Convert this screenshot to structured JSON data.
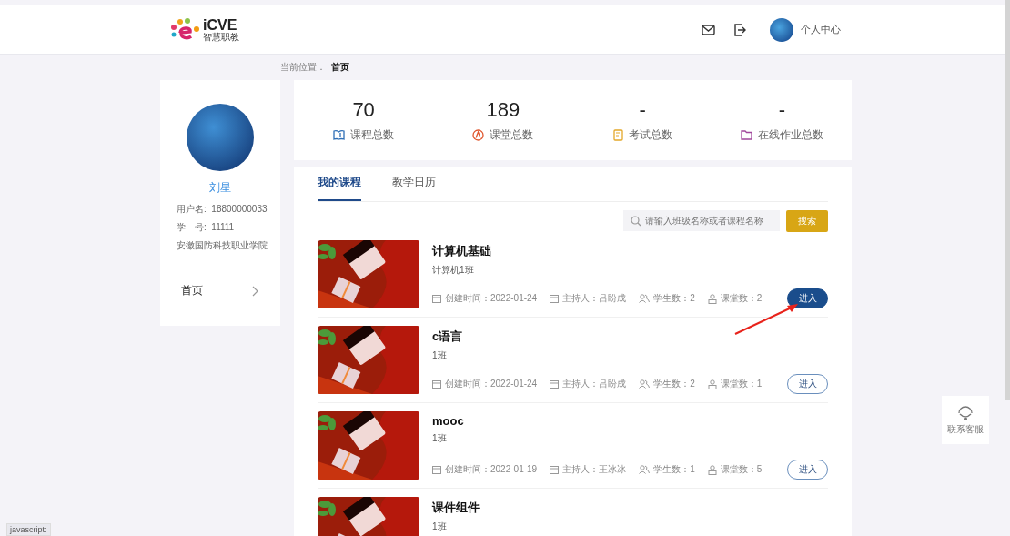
{
  "header": {
    "logo_text": "iCVE",
    "logo_subtext": "智慧职教",
    "user_link": "个人中心"
  },
  "breadcrumb": {
    "label": "当前位置：",
    "current": "首页"
  },
  "profile": {
    "name": "刘星",
    "fields": [
      {
        "label": "用户名:",
        "value": "18800000033"
      },
      {
        "label": "学　号:",
        "value": "11111"
      }
    ],
    "school": "安徽国防科技职业学院",
    "nav": [
      {
        "label": "首页"
      }
    ]
  },
  "stats": [
    {
      "kind": "course",
      "value": "70",
      "label": "课程总数"
    },
    {
      "kind": "classroom",
      "value": "189",
      "label": "课堂总数"
    },
    {
      "kind": "exam",
      "value": "-",
      "label": "考试总数"
    },
    {
      "kind": "homework",
      "value": "-",
      "label": "在线作业总数"
    }
  ],
  "tabs": [
    {
      "label": "我的课程",
      "selected": true
    },
    {
      "label": "教学日历",
      "selected": false
    }
  ],
  "search": {
    "placeholder": "请输入班级名称或者课程名称",
    "button": "搜索"
  },
  "courses": [
    {
      "title": "计算机基础",
      "class": "计算机1班",
      "meta": [
        {
          "kind": "date",
          "text": "创建时间：2022-01-24"
        },
        {
          "kind": "host",
          "text": "主持人：吕盼成"
        },
        {
          "kind": "students",
          "text": "学生数：2"
        },
        {
          "kind": "classes",
          "text": "课堂数：2"
        }
      ],
      "button": "进入",
      "highlighted": true
    },
    {
      "title": "c语言",
      "class": "1班",
      "meta": [
        {
          "kind": "date",
          "text": "创建时间：2022-01-24"
        },
        {
          "kind": "host",
          "text": "主持人：吕盼成"
        },
        {
          "kind": "students",
          "text": "学生数：2"
        },
        {
          "kind": "classes",
          "text": "课堂数：1"
        }
      ],
      "button": "进入",
      "highlighted": false
    },
    {
      "title": "mooc",
      "class": "1班",
      "meta": [
        {
          "kind": "date",
          "text": "创建时间：2022-01-19"
        },
        {
          "kind": "host",
          "text": "主持人：王冰冰"
        },
        {
          "kind": "students",
          "text": "学生数：1"
        },
        {
          "kind": "classes",
          "text": "课堂数：5"
        }
      ],
      "button": "进入",
      "highlighted": false
    },
    {
      "title": "课件组件",
      "class": "1班"
    }
  ],
  "support": {
    "label": "联系客服"
  },
  "status_text": "javascript:"
}
